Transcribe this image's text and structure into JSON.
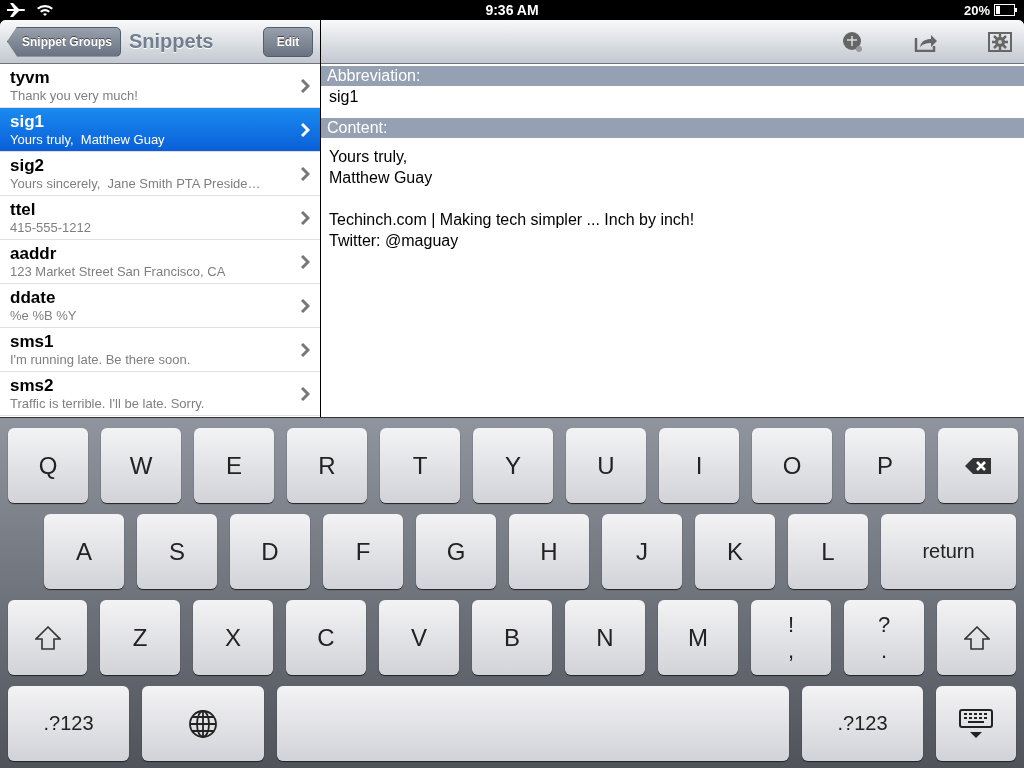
{
  "status_bar": {
    "time": "9:36 AM",
    "battery": "20%"
  },
  "nav_bar": {
    "back": "Snippet Groups",
    "title": "Snippets",
    "edit": "Edit"
  },
  "snippets": [
    {
      "name": "tyvm",
      "preview": "Thank you very much!",
      "selected": false
    },
    {
      "name": "sig1",
      "preview": "Yours truly,  Matthew Guay",
      "selected": true
    },
    {
      "name": "sig2",
      "preview": "Yours sincerely,  Jane Smith PTA Preside…",
      "selected": false
    },
    {
      "name": "ttel",
      "preview": "415-555-1212",
      "selected": false
    },
    {
      "name": "aaddr",
      "preview": "123 Market Street San Francisco, CA",
      "selected": false
    },
    {
      "name": "ddate",
      "preview": "%e %B %Y",
      "selected": false
    },
    {
      "name": "sms1",
      "preview": "I'm running late. Be there soon.",
      "selected": false
    },
    {
      "name": "sms2",
      "preview": "Traffic is terrible. I'll be late. Sorry.",
      "selected": false
    }
  ],
  "detail": {
    "abbreviation_label": "Abbreviation:",
    "abbreviation": "sig1",
    "content_label": "Content:",
    "content": [
      "Yours truly,\nMatthew Guay",
      "Techinch.com | Making tech simpler ... Inch by inch!\nTwitter: @maguay"
    ]
  },
  "keyboard": [
    [
      {
        "kind": "letter",
        "label": "Q"
      },
      {
        "kind": "letter",
        "label": "W"
      },
      {
        "kind": "letter",
        "label": "E"
      },
      {
        "kind": "letter",
        "label": "R"
      },
      {
        "kind": "letter",
        "label": "T"
      },
      {
        "kind": "letter",
        "label": "Y"
      },
      {
        "kind": "letter",
        "label": "U"
      },
      {
        "kind": "letter",
        "label": "I"
      },
      {
        "kind": "letter",
        "label": "O"
      },
      {
        "kind": "letter",
        "label": "P"
      },
      {
        "kind": "backspace"
      }
    ],
    [
      {
        "kind": "letter",
        "label": "A"
      },
      {
        "kind": "letter",
        "label": "S"
      },
      {
        "kind": "letter",
        "label": "D"
      },
      {
        "kind": "letter",
        "label": "F"
      },
      {
        "kind": "letter",
        "label": "G"
      },
      {
        "kind": "letter",
        "label": "H"
      },
      {
        "kind": "letter",
        "label": "J"
      },
      {
        "kind": "letter",
        "label": "K"
      },
      {
        "kind": "letter",
        "label": "L"
      },
      {
        "kind": "action",
        "label": "return"
      }
    ],
    [
      {
        "kind": "shift"
      },
      {
        "kind": "letter",
        "label": "Z"
      },
      {
        "kind": "letter",
        "label": "X"
      },
      {
        "kind": "letter",
        "label": "C"
      },
      {
        "kind": "letter",
        "label": "V"
      },
      {
        "kind": "letter",
        "label": "B"
      },
      {
        "kind": "letter",
        "label": "N"
      },
      {
        "kind": "letter",
        "label": "M"
      },
      {
        "kind": "double",
        "label": "!",
        "sub": ","
      },
      {
        "kind": "double",
        "label": "?",
        "sub": "."
      },
      {
        "kind": "shift"
      }
    ],
    [
      {
        "kind": "mode",
        "label": ".?123"
      },
      {
        "kind": "globe"
      },
      {
        "kind": "space"
      },
      {
        "kind": "mode",
        "label": ".?123"
      },
      {
        "kind": "hide"
      }
    ]
  ]
}
